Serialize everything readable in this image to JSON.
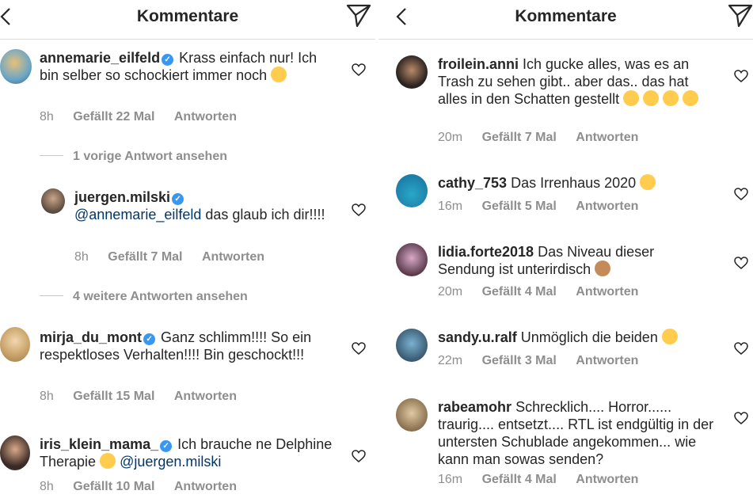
{
  "left": {
    "header": {
      "title": "Kommentare"
    },
    "comments": [
      {
        "user": "annemarie_eilfeld",
        "text": "Krass einfach nur! Ich bin selber so schockiert immer noch",
        "time": "8h",
        "likes": "Gefällt 22 Mal",
        "reply": "Antworten"
      },
      {
        "user": "juergen.milski",
        "mention": "@annemarie_eilfeld",
        "text": "das glaub ich dir!!!!",
        "time": "8h",
        "likes": "Gefällt 7 Mal",
        "reply": "Antworten"
      },
      {
        "user": "mirja_du_mont",
        "text": "Ganz schlimm!!!! So ein respektloses Verhalten!!!! Bin geschockt!!!",
        "time": "8h",
        "likes": "Gefällt 15 Mal",
        "reply": "Antworten"
      },
      {
        "user": "iris_klein_mama_",
        "text": "Ich brauche ne Delphine Therapie",
        "mention": "@juergen.milski",
        "time": "8h",
        "likes": "Gefällt 10 Mal",
        "reply": "Antworten"
      }
    ],
    "view_replies_1": "1 vorige Antwort ansehen",
    "view_replies_2": "4 weitere Antworten ansehen"
  },
  "right": {
    "header": {
      "title": "Kommentare"
    },
    "comments": [
      {
        "user": "froilein.anni",
        "text": "Ich gucke alles, was es an Trash zu sehen gibt.. aber das.. das hat alles in den Schatten gestellt",
        "time": "20m",
        "likes": "Gefällt 7 Mal",
        "reply": "Antworten"
      },
      {
        "user": "cathy_753",
        "text": "Das Irrenhaus 2020",
        "time": "16m",
        "likes": "Gefällt 5 Mal",
        "reply": "Antworten"
      },
      {
        "user": "lidia.forte2018",
        "text": "Das Niveau dieser Sendung ist unterirdisch",
        "time": "20m",
        "likes": "Gefällt 4 Mal",
        "reply": "Antworten"
      },
      {
        "user": "sandy.u.ralf",
        "text": "Unmöglich die beiden",
        "time": "22m",
        "likes": "Gefällt 3 Mal",
        "reply": "Antworten"
      },
      {
        "user": "rabeamohr",
        "text": "Schrecklich.... Horror...... traurig.... entsetzt.... RTL ist endgültig in der untersten Schublade angekommen... wie kann man sowas senden?",
        "time": "16m",
        "likes": "Gefällt 4 Mal",
        "reply": "Antworten"
      }
    ]
  },
  "colors": {
    "verified": "#3897f0",
    "mention": "#00376b",
    "meta": "#8e8e8e",
    "text": "#262626"
  }
}
